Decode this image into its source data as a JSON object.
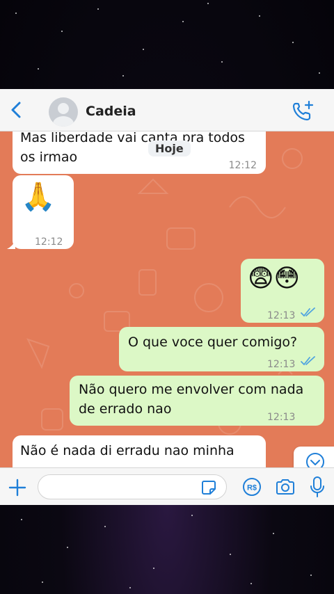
{
  "header": {
    "contact_name": "Cadeia",
    "back_icon": "chevron-left-icon",
    "call_icon": "phone-plus-icon"
  },
  "date_chip": "Hoje",
  "messages": [
    {
      "direction": "in",
      "text_line1": "Mas liberdade vai canta pra todos",
      "text_line2": "os irmao",
      "time": "12:12"
    },
    {
      "direction": "in",
      "emoji": "🙏",
      "time": "12:12"
    },
    {
      "direction": "out",
      "emoji": "😨😳",
      "time": "12:13",
      "status": "read"
    },
    {
      "direction": "out",
      "text": "O que voce quer comigo?",
      "time": "12:13",
      "status": "read"
    },
    {
      "direction": "out",
      "text_line1": "Não quero me envolver com nada",
      "text_line2": "de errado nao",
      "time": "12:13"
    },
    {
      "direction": "in",
      "text_line1": "Não é nada di erradu nao minha",
      "text_line2": ""
    }
  ],
  "composer": {
    "placeholder": "",
    "icons": [
      "plus-icon",
      "sticker-icon",
      "pix-icon",
      "camera-icon",
      "microphone-icon"
    ]
  },
  "colors": {
    "chat_background": "#e37b58",
    "incoming_bubble": "#ffffff",
    "outgoing_bubble": "#dcf8c6",
    "accent_blue": "#1f7fd8",
    "read_ticks": "#4fa3e0"
  }
}
